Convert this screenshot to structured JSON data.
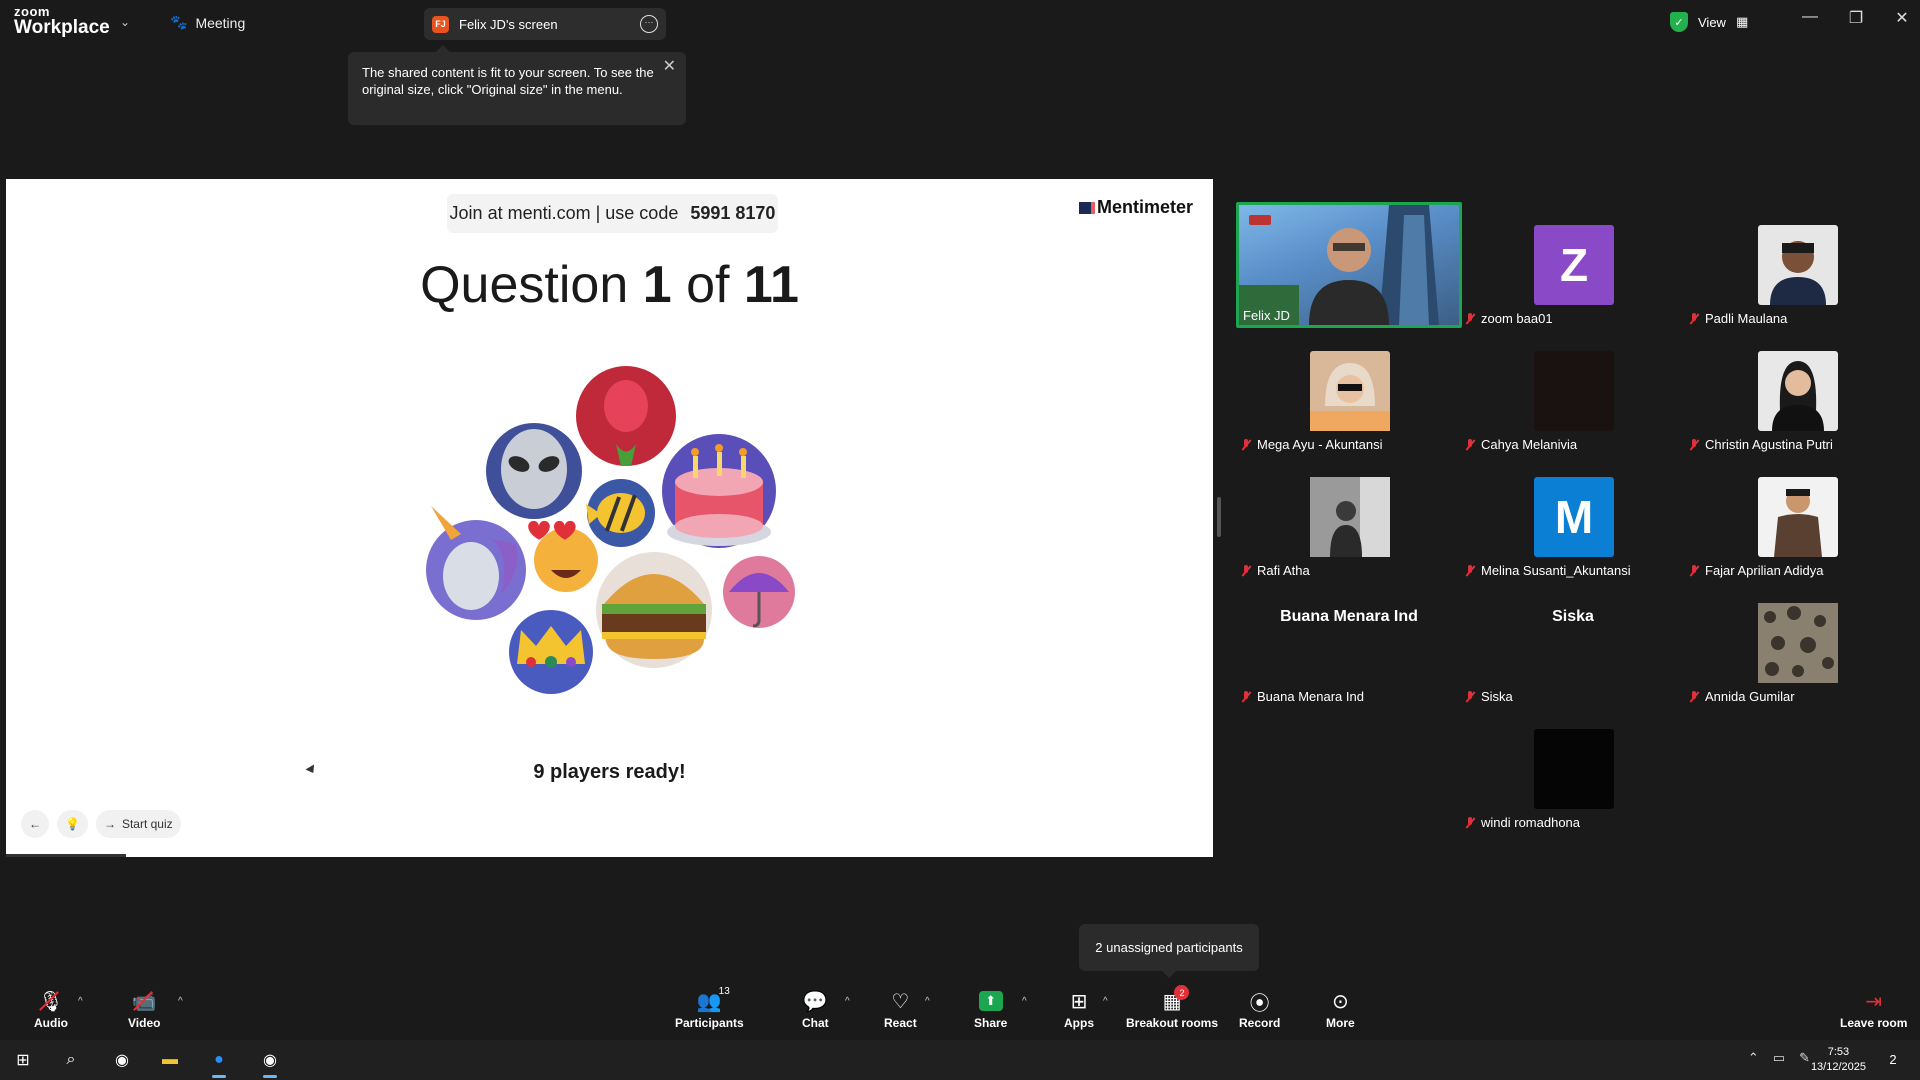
{
  "titlebar": {
    "brand_top": "zoom",
    "brand_bottom": "Workplace",
    "meeting_label": "Meeting",
    "screen_tab_initials": "FJ",
    "screen_tab_name": "Felix JD's screen",
    "view_label": "View"
  },
  "notice": {
    "text": "The shared content is fit to your screen. To see the original size, click \"Original size\" in the menu."
  },
  "slide": {
    "join_text": "Join at menti.com | use code",
    "join_code": "5991 8170",
    "logo": "Mentimeter",
    "question_word": "Question",
    "question_num": "1",
    "question_of": "of",
    "question_total": "11",
    "players_ready": "9 players ready!",
    "start_quiz": "Start quiz"
  },
  "gallery": [
    {
      "name": "Felix JD",
      "muted": false,
      "active": true
    },
    {
      "name": "zoom baa01",
      "initial": "Z",
      "muted": true,
      "color": "#8a49c6"
    },
    {
      "name": "Padli Maulana",
      "muted": true
    },
    {
      "name": "Mega Ayu - Akuntansi",
      "muted": true
    },
    {
      "name": "Cahya Melanivia",
      "muted": true
    },
    {
      "name": "Christin Agustina Putri",
      "muted": true
    },
    {
      "name": "Rafi Atha",
      "muted": true
    },
    {
      "name": "Melina Susanti_Akuntansi",
      "initial": "M",
      "muted": true,
      "color": "#0b7fd4"
    },
    {
      "name": "Fajar Aprilian Adidya",
      "muted": true
    },
    {
      "name": "Buana Menara Ind",
      "display": "Buana Menara Ind",
      "muted": true
    },
    {
      "name": "Siska",
      "display": "Siska",
      "muted": true
    },
    {
      "name": "Annida Gumilar",
      "muted": true
    },
    {
      "name": "windi romadhona",
      "muted": true
    }
  ],
  "breakout_tip": "2 unassigned participants",
  "toolbar": {
    "audio": "Audio",
    "video": "Video",
    "participants": "Participants",
    "participants_count": "13",
    "chat": "Chat",
    "react": "React",
    "share": "Share",
    "apps": "Apps",
    "breakout": "Breakout rooms",
    "breakout_badge": "2",
    "record": "Record",
    "more": "More",
    "leave": "Leave room"
  },
  "taskbar": {
    "time": "7:53",
    "date": "13/12/2025",
    "notif_count": "2"
  },
  "colors": {
    "accent_green": "#1da650",
    "muted_red": "#e0303a",
    "bg": "#1a1a1a"
  }
}
